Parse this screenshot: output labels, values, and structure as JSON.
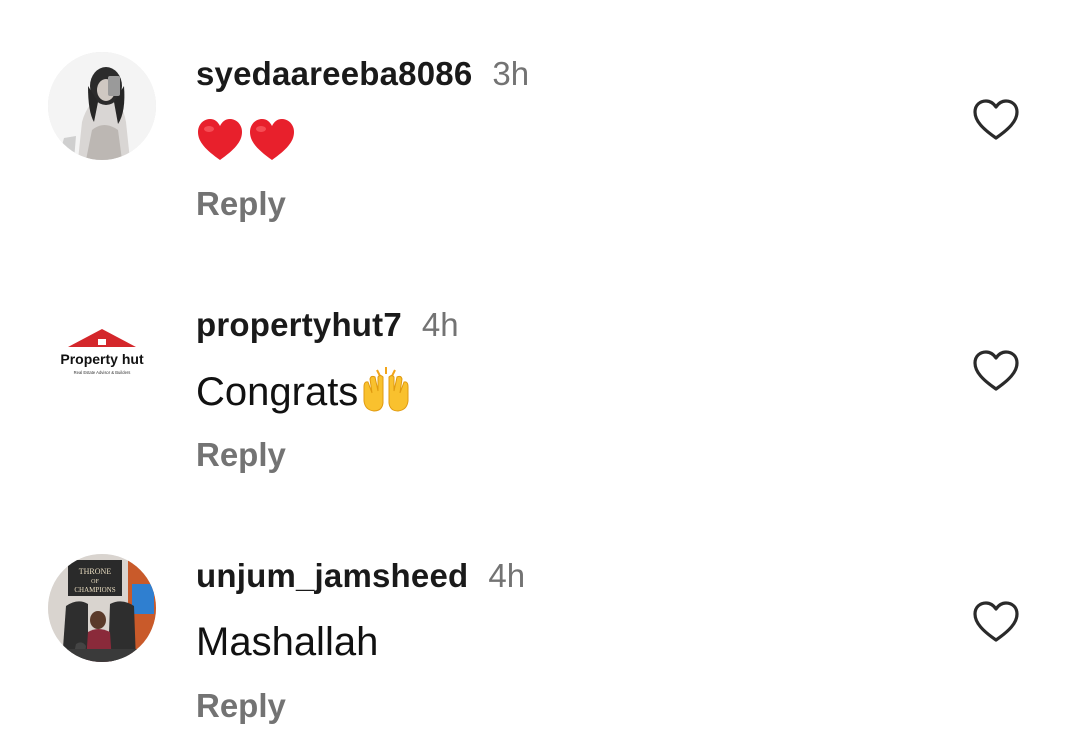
{
  "comments": [
    {
      "username": "syedaareeba8086",
      "time": "3h",
      "text": "",
      "emoji": "red-hearts-emoji",
      "reply_label": "Reply",
      "avatar": "person-photo-avatar"
    },
    {
      "username": "propertyhut7",
      "time": "4h",
      "text": "Congrats",
      "emoji": "raising-hands-emoji",
      "reply_label": "Reply",
      "avatar": "property-hut-logo-avatar",
      "avatar_logo_text": "Property hut",
      "avatar_logo_subtext": "Real Estate Advisor & Builders"
    },
    {
      "username": "unjum_jamsheed",
      "time": "4h",
      "text": "Mashallah",
      "reply_label": "Reply",
      "avatar": "person-photo-avatar",
      "avatar_sign_text": "THRONE OF CHAMPIONS"
    }
  ],
  "colors": {
    "text": "#111111",
    "muted": "#737373",
    "heart_red": "#e8202c",
    "logo_red": "#d4272b",
    "emoji_yellow": "#f9c12e"
  }
}
